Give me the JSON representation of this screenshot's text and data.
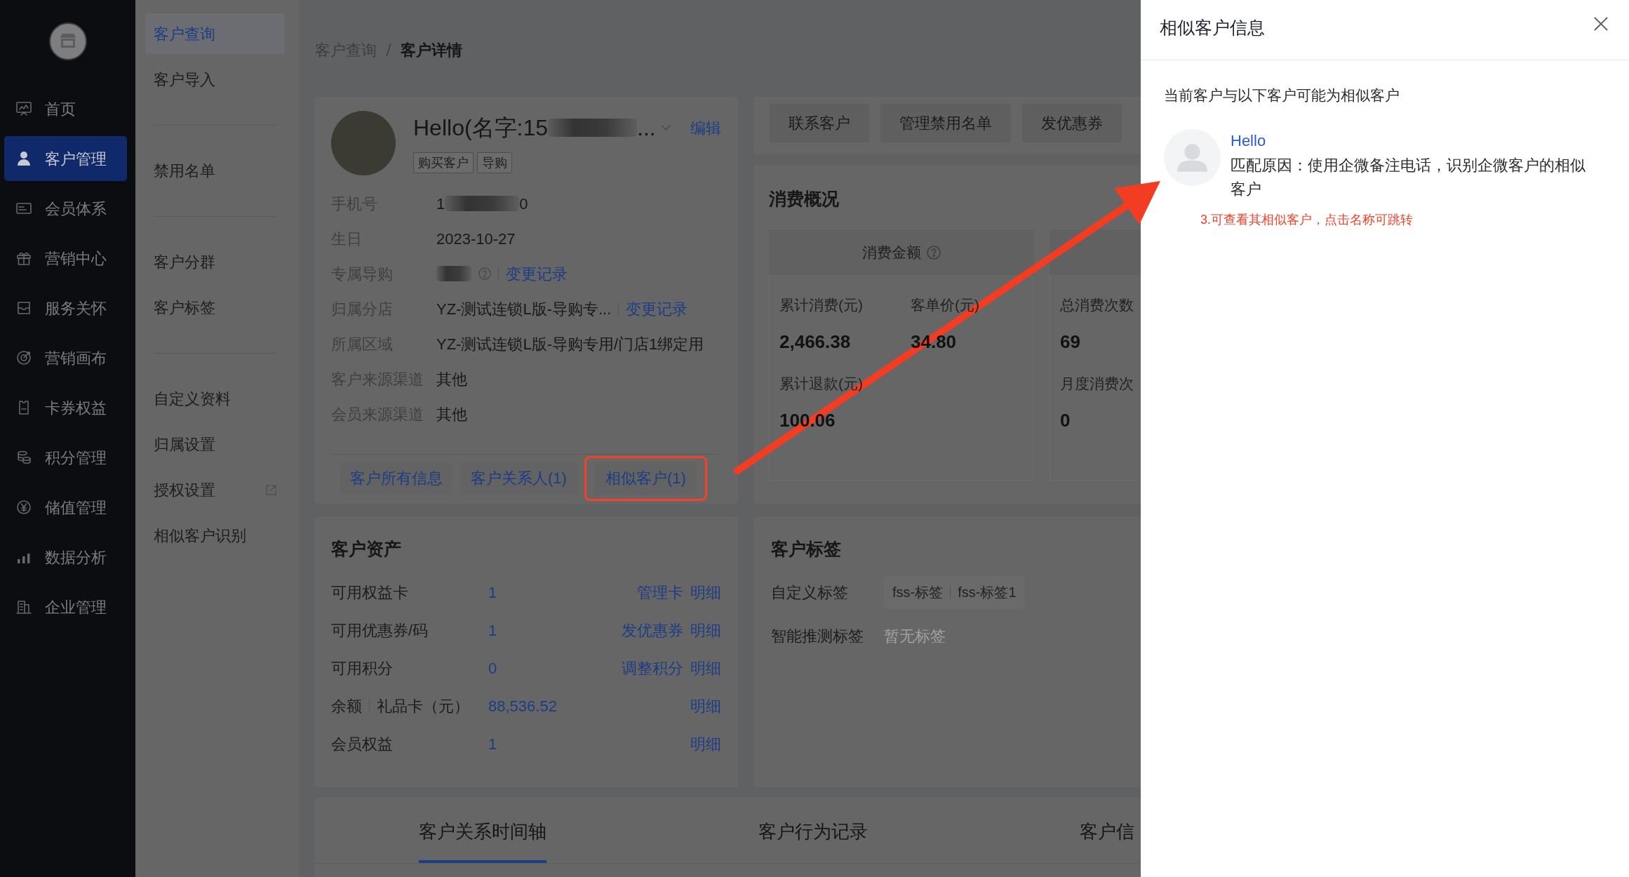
{
  "sidebar": {
    "items": [
      {
        "label": "首页",
        "selected": false
      },
      {
        "label": "客户管理",
        "selected": true
      },
      {
        "label": "会员体系",
        "selected": false
      },
      {
        "label": "营销中心",
        "selected": false
      },
      {
        "label": "服务关怀",
        "selected": false
      },
      {
        "label": "营销画布",
        "selected": false
      },
      {
        "label": "卡券权益",
        "selected": false
      },
      {
        "label": "积分管理",
        "selected": false
      },
      {
        "label": "储值管理",
        "selected": false
      },
      {
        "label": "数据分析",
        "selected": false
      },
      {
        "label": "企业管理",
        "selected": false
      }
    ]
  },
  "submenu": {
    "groups": [
      {
        "items": [
          {
            "label": "客户查询",
            "selected": true,
            "external": false
          },
          {
            "label": "客户导入",
            "selected": false,
            "external": false
          }
        ]
      },
      {
        "items": [
          {
            "label": "禁用名单",
            "selected": false,
            "external": false
          }
        ]
      },
      {
        "items": [
          {
            "label": "客户分群",
            "selected": false,
            "external": false
          },
          {
            "label": "客户标签",
            "selected": false,
            "external": false
          }
        ]
      },
      {
        "items": [
          {
            "label": "自定义资料",
            "selected": false,
            "external": false
          },
          {
            "label": "归属设置",
            "selected": false,
            "external": false
          },
          {
            "label": "授权设置",
            "selected": false,
            "external": true
          },
          {
            "label": "相似客户识别",
            "selected": false,
            "external": false
          }
        ]
      }
    ]
  },
  "breadcrumb": [
    {
      "label": "客户查询",
      "current": false
    },
    {
      "label": "客户详情",
      "current": true
    }
  ],
  "profile": {
    "name": "Hello(名字:15",
    "name_redacted": true,
    "name_end": "...",
    "edit": "编辑",
    "tags": [
      "购买客户",
      "导购"
    ],
    "fields": [
      {
        "label": "手机号",
        "value": "1",
        "redacted": true,
        "value_end": "0",
        "help": false
      },
      {
        "label": "生日",
        "value": "2023-10-27",
        "redacted": false,
        "help": false
      },
      {
        "label": "专属导购",
        "redacted": true,
        "help": true,
        "link": "变更记录"
      },
      {
        "label": "归属分店",
        "value": "YZ-测试连锁L版-导购专...",
        "redacted": false,
        "help": false,
        "link": "变更记录"
      },
      {
        "label": "所属区域",
        "value": "YZ-测试连锁L版-导购专用/门店1绑定用",
        "redacted": false,
        "help": false
      },
      {
        "label": "客户来源渠道",
        "value": "其他",
        "redacted": false,
        "help": false
      },
      {
        "label": "会员来源渠道",
        "value": "其他",
        "redacted": false,
        "help": false
      }
    ],
    "tabs": [
      {
        "label": "客户所有信息",
        "highlighted": false
      },
      {
        "label": "客户关系人(1)",
        "highlighted": false
      },
      {
        "label": "相似客户(1)",
        "highlighted": true
      }
    ]
  },
  "actions": [
    "联系客户",
    "管理禁用名单",
    "发优惠券"
  ],
  "consumption": {
    "title": "消费概况",
    "panels": [
      {
        "header": "消费金额",
        "help": true,
        "stats": [
          {
            "label": "累计消费(元)",
            "value": "2,466.38"
          },
          {
            "label": "客单价(元)",
            "value": "34.80"
          },
          {
            "label": "累计退款(元)",
            "value": "100.06"
          }
        ]
      },
      {
        "help": false,
        "stats": [
          {
            "label": "总消费次数",
            "value": "69"
          },
          {
            "label": "月度消费次",
            "value": "0"
          }
        ]
      }
    ]
  },
  "assets": {
    "title": "客户资产",
    "rows": [
      {
        "label": "可用权益卡",
        "value": "1",
        "actions": [
          "管理卡",
          "明细"
        ]
      },
      {
        "label": "可用优惠券/码",
        "value": "1",
        "actions": [
          "发优惠券",
          "明细"
        ]
      },
      {
        "label": "可用积分",
        "value": "0",
        "actions": [
          "调整积分",
          "明细"
        ]
      },
      {
        "label": "余额",
        "sublabel": "礼品卡（元）",
        "value": "88,536.52",
        "actions": [
          "明细"
        ]
      },
      {
        "label": "会员权益",
        "value": "1",
        "actions": [
          "明细"
        ]
      }
    ]
  },
  "customer_tags": {
    "title": "客户标签",
    "rows": [
      {
        "label": "自定义标签",
        "tags": [
          "fss-标签",
          "fss-标签1"
        ]
      },
      {
        "label": "智能推测标签",
        "empty": "暂无标签"
      }
    ]
  },
  "detail_tabs": [
    {
      "label": "客户关系时间轴",
      "selected": true
    },
    {
      "label": "客户行为记录",
      "selected": false
    },
    {
      "label": "客户信",
      "selected": false
    }
  ],
  "drawer": {
    "title": "相似客户信息",
    "intro": "当前客户与以下客户可能为相似客户",
    "customers": [
      {
        "name": "Hello",
        "reason": "匹配原因：使用企微备注电话，识别企微客户的相似客户"
      }
    ],
    "note": "3.可查看其相似客户，点击名称可跳转"
  }
}
